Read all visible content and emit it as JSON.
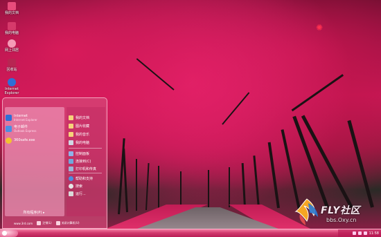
{
  "desktop_icons": [
    {
      "label": "我的文档",
      "color": "#e84c7c"
    },
    {
      "label": "我的电脑",
      "color": "#d63a6b"
    },
    {
      "label": "网上邻居",
      "color": "#f59ab6"
    },
    {
      "label": "回收站",
      "color": "#b82552"
    },
    {
      "label": "Internet Explorer",
      "color": "#2f6fd6"
    }
  ],
  "start_menu": {
    "pinned": [
      {
        "title": "Internet",
        "sub": "Internet Explorer",
        "color": "#2f6fd6"
      },
      {
        "title": "电子邮件",
        "sub": "Outlook Express",
        "color": "#4a90e2"
      },
      {
        "title": "360safe.exe",
        "sub": "",
        "color": "#f2c230"
      }
    ],
    "right_items": [
      {
        "label": "我的文档",
        "color": "#f6d27a"
      },
      {
        "label": "图片收藏",
        "color": "#f6d27a"
      },
      {
        "label": "我的音乐",
        "color": "#f6d27a"
      },
      {
        "label": "我的电脑",
        "color": "#cfd8e4"
      },
      {
        "label": "控制面板",
        "color": "#8fb3e8"
      },
      {
        "label": "连接到(C)",
        "color": "#6fa8dc"
      },
      {
        "label": "打印机和传真",
        "color": "#9bb6d8"
      },
      {
        "label": "帮助和支持",
        "color": "#4a8ee0"
      },
      {
        "label": "搜索",
        "color": "#e6e6e6"
      },
      {
        "label": "运行...",
        "color": "#d9d9d9"
      }
    ],
    "all_programs": "所有程序(P)",
    "footer": {
      "user": "www.3rd.com",
      "logoff": "注销(L)",
      "shutdown": "关闭计算机(U)"
    }
  },
  "taskbar": {
    "clock": "11:58",
    "tray_icons": [
      "volume-icon",
      "network-icon",
      "security-icon"
    ]
  },
  "watermark": {
    "title": "FLY社区",
    "site": "bbs.Oxy.cn"
  },
  "colors": {
    "accent": "#e0306a",
    "taskbar": "#d23a6e",
    "start_menu": "#d64878"
  }
}
